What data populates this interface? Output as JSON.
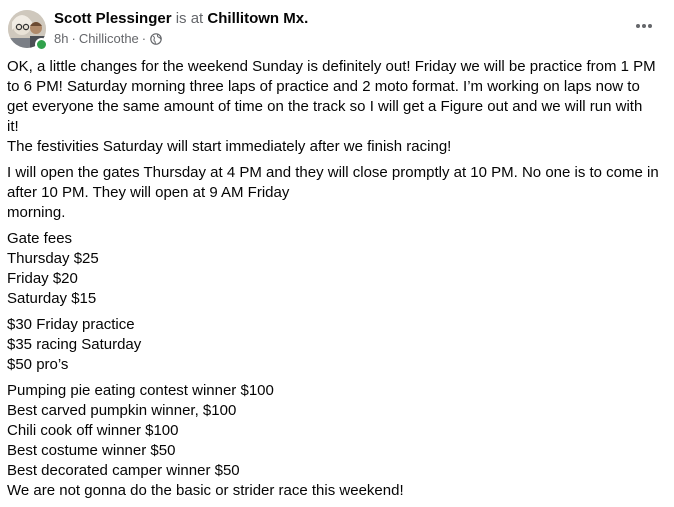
{
  "post": {
    "author": "Scott Plessinger",
    "is_at": "is at",
    "location": "Chillitown Mx.",
    "time": "8h",
    "separator": "·",
    "place": "Chillicothe",
    "privacy_icon": "globe-icon",
    "more_icon": "more-options-icon",
    "body": [
      {
        "lines": [
          "OK, a little changes for the weekend Sunday is definitely out! Friday we will be practice from 1 PM",
          "to 6 PM! Saturday morning three laps of practice and 2 moto format. I’m working on laps now to",
          "get everyone the same amount of time on the track so I will get a Figure out and we will run with",
          "it!",
          "  The festivities Saturday will start immediately after we finish racing!"
        ]
      },
      {
        "lines": [
          "I will open the gates Thursday at 4 PM and they will close promptly at 10 PM. No one is to come in",
          "after 10 PM. They will open at 9 AM Friday",
          "morning."
        ]
      },
      {
        "lines": [
          "Gate fees",
          "Thursday $25",
          "Friday $20",
          "Saturday $15"
        ]
      },
      {
        "lines": [
          "$30 Friday practice",
          "$35 racing Saturday",
          "$50 pro’s"
        ]
      },
      {
        "lines": [
          "Pumping pie eating contest winner $100",
          "Best carved pumpkin winner, $100",
          "Chili cook off winner $100",
          "Best costume winner $50",
          "Best decorated camper winner $50",
          "We are not gonna do the basic or strider race this weekend!"
        ]
      }
    ]
  }
}
